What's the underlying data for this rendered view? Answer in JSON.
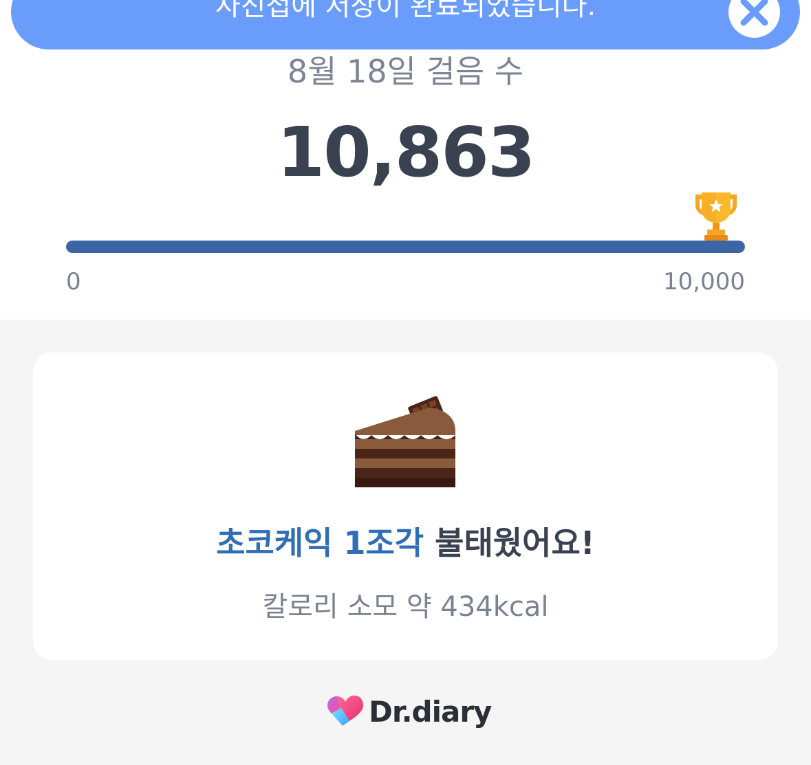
{
  "toast": {
    "message": "사진첩에 저장이 완료되었습니다.",
    "close_icon": "close-icon",
    "color": "#699cfb"
  },
  "steps": {
    "date_label": "8월 18일 걸음 수",
    "count": "10,863",
    "goal_min_label": "0",
    "goal_max_label": "10,000",
    "progress_fraction": 1.0,
    "goal_icon": "trophy-icon",
    "bar_color": "#3b66a5"
  },
  "achievement": {
    "icon": "chocolate-cake-icon",
    "food_highlight": "초코케익 1조각",
    "headline_rest": " 불태웠어요!",
    "calorie_text": "칼로리 소모 약 434kcal",
    "highlight_color": "#2f6db5"
  },
  "brand": {
    "name": "Dr.diary",
    "logo": "heart-logo-icon"
  }
}
